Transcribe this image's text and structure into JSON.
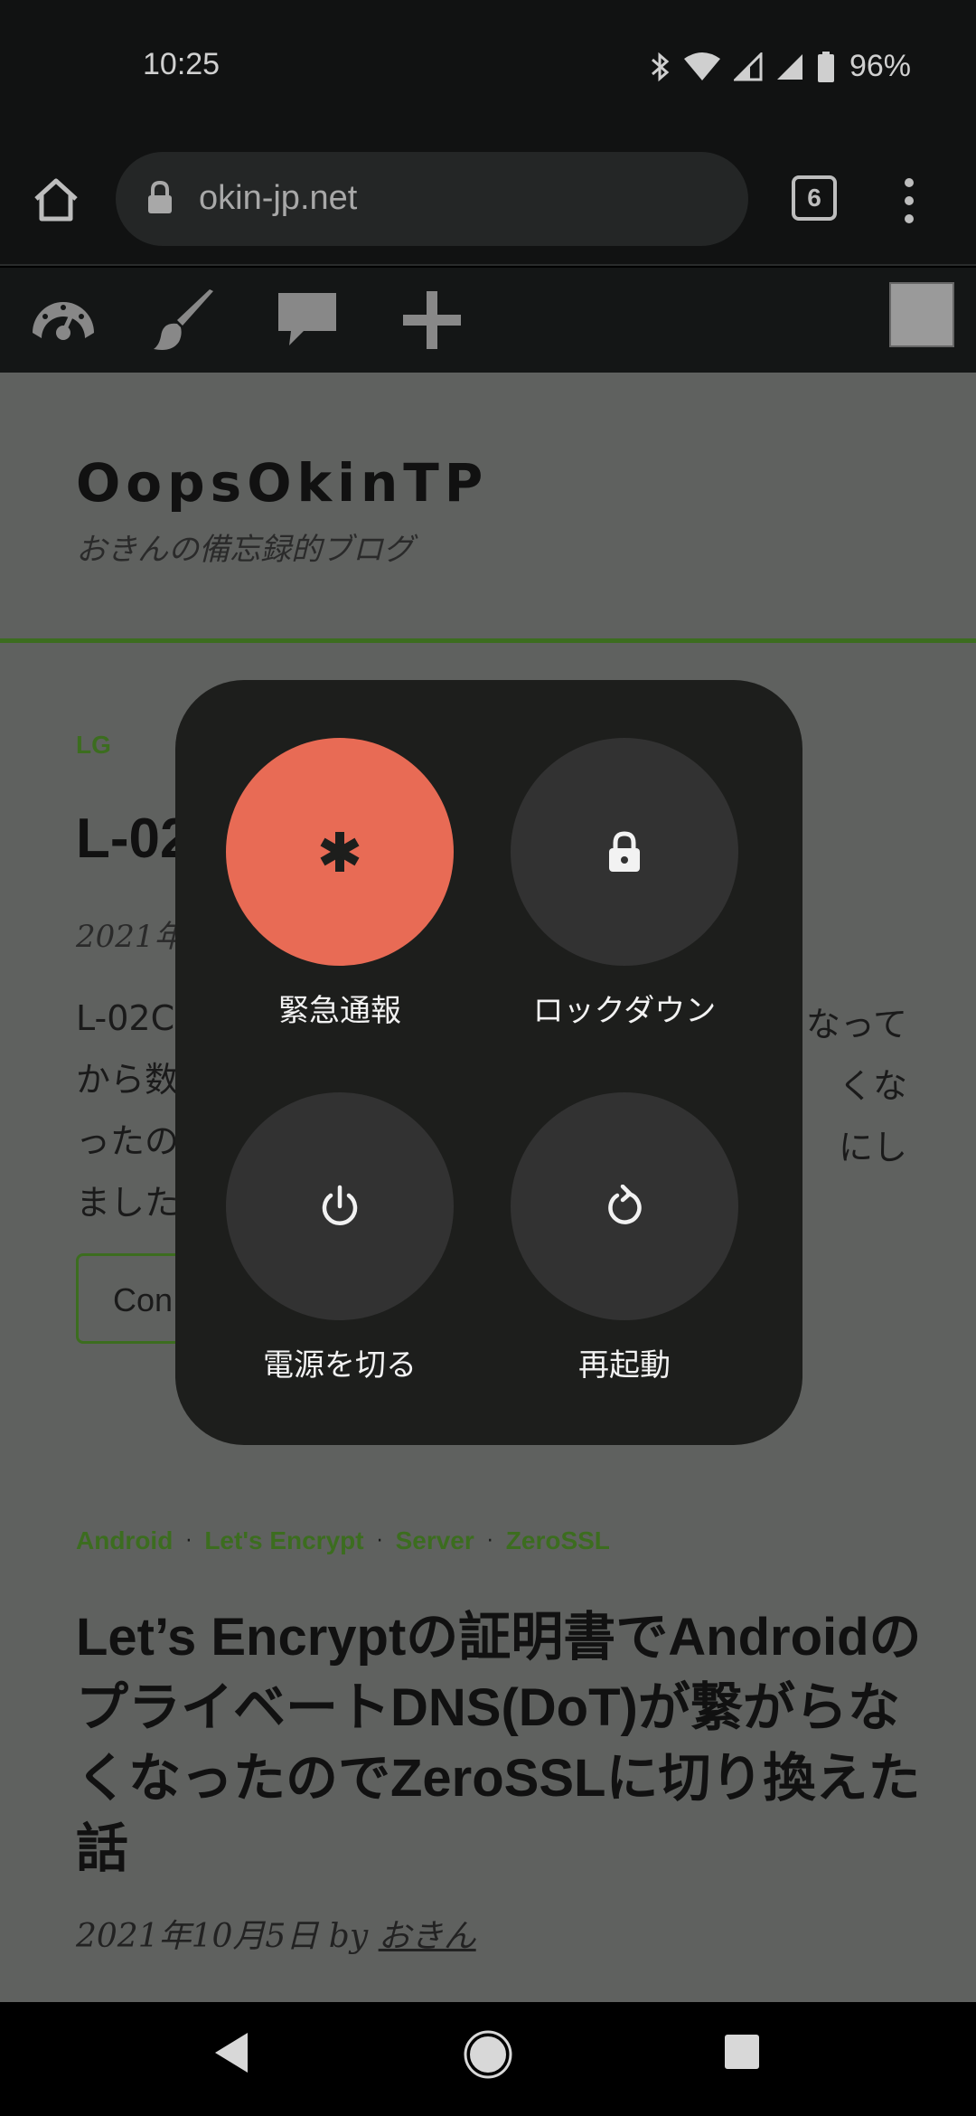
{
  "status_bar": {
    "time": "10:25",
    "battery_percent": "96%",
    "icons": [
      "bluetooth-icon",
      "wifi-icon",
      "signal-icon",
      "signal-icon",
      "battery-icon"
    ]
  },
  "browser": {
    "url": "okin-jp.net",
    "tab_count": "6",
    "icons": [
      "home-icon",
      "lock-icon",
      "tab-switcher-icon",
      "more-vert-icon"
    ]
  },
  "admin_bar": {
    "icons": [
      "dashboard-icon",
      "customize-brush-icon",
      "comments-icon",
      "new-content-plus-icon",
      "avatar"
    ]
  },
  "site": {
    "title": "OopsOkinTP",
    "description": "おきんの備忘録的ブログ"
  },
  "post1": {
    "category": "LG",
    "title_visible": "L-02",
    "date_visible": "2021年",
    "excerpt_left": [
      "L-02C",
      "から数",
      "ったの",
      "ました"
    ],
    "excerpt_right": [
      "なって",
      "くな",
      "にし"
    ],
    "continue_visible": "Con"
  },
  "post2": {
    "categories": [
      "Android",
      "Let's Encrypt",
      "Server",
      "ZeroSSL"
    ],
    "separator": "·",
    "title": "Let’s Encryptの証明書でAndroidのプライベートDNS(DoT)が繋がらなくなったのでZeroSSLに切り換えた話",
    "date": "2021年10月5日",
    "by": "by",
    "author": "おきん"
  },
  "power_menu": {
    "actions": [
      {
        "label": "緊急通報",
        "icon": "emergency-asterisk-icon",
        "color": "#e86b55"
      },
      {
        "label": "ロックダウン",
        "icon": "lock-icon",
        "color": "#323232"
      },
      {
        "label": "電源を切る",
        "icon": "power-icon",
        "color": "#323232"
      },
      {
        "label": "再起動",
        "icon": "restart-icon",
        "color": "#323232"
      }
    ]
  },
  "nav_bar": {
    "icons": [
      "back-icon",
      "home-icon",
      "recents-icon"
    ]
  },
  "colors": {
    "accent_green": "#3c6d1f",
    "emergency_red": "#e86b55",
    "dialog_bg": "#1d1e1c"
  }
}
